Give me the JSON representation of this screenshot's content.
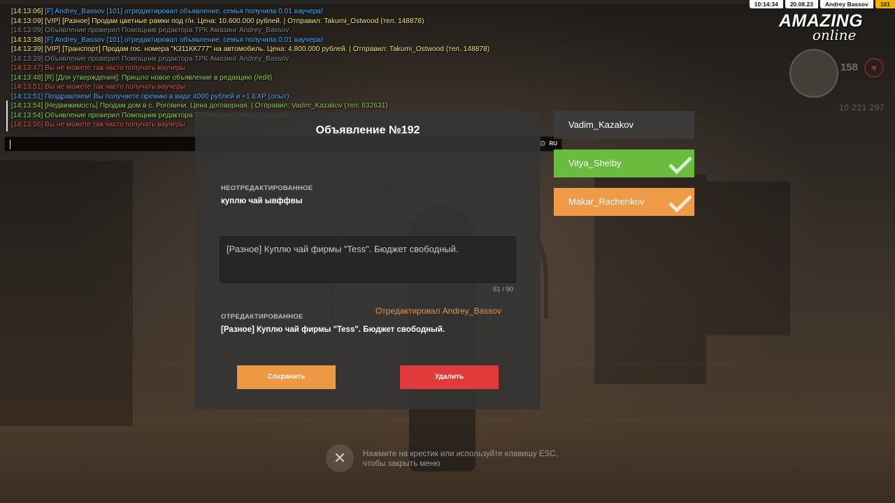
{
  "chat": {
    "lines": [
      {
        "time": "[14:13:06]",
        "text": "[F] Andrey_Bassov [101] отредактировал объявление, семья получила 0.01 ваучера!",
        "kind": "info"
      },
      {
        "time": "[14:13:09]",
        "text": "[VIP] [Разное] Продам цветные рамки под г/н. Цена: 10.600.000 рублей. | Отправил: Takumi_Ostwood (тел. 148878)",
        "kind": "vip"
      },
      {
        "time": "[14:13:09]",
        "text": "Объявление проверил Помощник редактора ТРК Амазинг Andrey_Bassov",
        "kind": "gray"
      },
      {
        "time": "[14:13:38]",
        "text": "[F] Andrey_Bassov [101] отредактировал объявление, семья получила 0.01 ваучера!",
        "kind": "info"
      },
      {
        "time": "[14:13:39]",
        "text": "[VIP] [Транспорт] Продам гос. номера \"К311КК777\" на автомобиль. Цена: 4.800.000 рублей. | Отправил: Takumi_Ostwood (тел. 148878)",
        "kind": "vip"
      },
      {
        "time": "[14:13:39]",
        "text": "Объявление проверил Помощник редактора ТРК Амазинг Andrey_Bassov",
        "kind": "gray"
      },
      {
        "time": "[14:13:47]",
        "text": "Вы не можете так часто получать ваучеры",
        "kind": "red"
      },
      {
        "time": "[14:13:48]",
        "text": "[R] [Для утверждения]: Пришло новое объявление в редакцию (/edit)",
        "kind": "green"
      },
      {
        "time": "[14:13:51]",
        "text": "Вы не можете так часто получать ваучеры",
        "kind": "red"
      },
      {
        "time": "[14:13:51]",
        "text": "Поздравляем! Вы получаете премию в виде 4000 рублей и +1 EXP (опыт)",
        "kind": "blue"
      },
      {
        "time": "[14:13:54]",
        "text": "[Недвижимость] Продам дом в с. Роговичи. Цена договорная. | Отправил: Vadim_Kazakov (тел. 632631)",
        "kind": "green"
      },
      {
        "time": "[14:13:54]",
        "text": "Объявление проверил Помощник редактора ТРК Амазинг Andrey_Bassov",
        "kind": "green"
      },
      {
        "time": "[14:13:56]",
        "text": "Вы не можете так часто получать ваучеры",
        "kind": "red"
      }
    ],
    "input_lang": "RU",
    "gear_icon": "gear-icon"
  },
  "hud": {
    "time": "10:14:34",
    "date": "20.08.23",
    "player": "Andrey Bassov",
    "level": "101",
    "logo_main": "AMAZING",
    "logo_sub": "online",
    "health": "158",
    "money": "10 221 297"
  },
  "dialog": {
    "title": "Объявление №192",
    "original_label": "НЕОТРЕДАКТИРОВАННОЕ",
    "original_text": "куплю чай ывффвы",
    "edit_value": "[Разное] Куплю чай фирмы \"Tess\". Бюджет свободный.",
    "counter": "51 / 90",
    "edited_by": "Отредактировал Andrey_Bassov",
    "edited_label": "ОТРЕДАКТИРОВАННОЕ",
    "edited_text": "[Разное] Куплю чай фирмы \"Tess\". Бюджет свободный.",
    "save_label": "Сохранить",
    "delete_label": "Удалить",
    "colors": {
      "save": "#ee9844",
      "delete": "#e03a3a"
    }
  },
  "side_list": {
    "items": [
      {
        "name": "Vadim_Kazakov",
        "status": "pending"
      },
      {
        "name": "Vitya_Shelby",
        "status": "approved-green"
      },
      {
        "name": "Makar_Rachenkov",
        "status": "approved-orange"
      }
    ]
  },
  "close": {
    "hint": "Нажмите на крестик или используйте клавишу ESC, чтобы закрыть меню",
    "icon": "close-icon"
  }
}
